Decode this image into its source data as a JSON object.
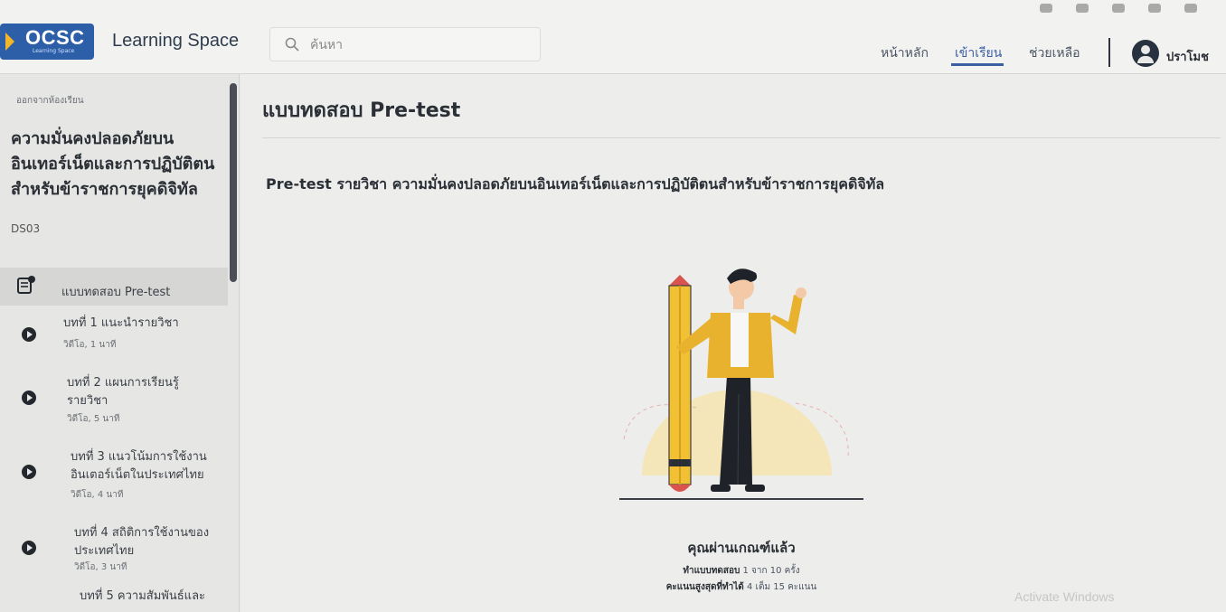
{
  "header": {
    "logo_text": "OCSC",
    "logo_subtext": "Learning Space",
    "app_title": "Learning Space",
    "search_placeholder": "ค้นหา",
    "nav": [
      {
        "label": "หน้าหลัก"
      },
      {
        "label": "เข้าเรียน"
      },
      {
        "label": "ช่วยเหลือ"
      }
    ],
    "user_name": "ปราโมช"
  },
  "sidebar": {
    "back_label": "ออกจากห้องเรียน",
    "course_title": "ความมั่นคงปลอดภัยบนอินเทอร์เน็ตและการปฏิบัติตนสำหรับข้าราชการยุคดิจิทัล",
    "course_code": "DS03",
    "pretest_label": "แบบทดสอบ Pre-test",
    "lessons": [
      {
        "title": "บทที่ 1 แนะนำรายวิชา",
        "meta": "วิดีโอ, 1 นาที"
      },
      {
        "title": "บทที่ 2 แผนการเรียนรู้รายวิชา",
        "meta": "วิดีโอ, 5 นาที"
      },
      {
        "title": "บทที่ 3 แนวโน้มการใช้งานอินเตอร์เน็ตในประเทศไทย",
        "meta": "วิดีโอ, 4 นาที"
      },
      {
        "title": "บทที่ 4 สถิติการใช้งานของประเทศไทย",
        "meta": "วิดีโอ, 3 นาที"
      },
      {
        "title": "บทที่ 5 ความสัมพันธ์และ",
        "meta": ""
      }
    ]
  },
  "main": {
    "page_title": "แบบทดสอบ Pre-test",
    "subtitle": "Pre-test รายวิชา ความมั่นคงปลอดภัยบนอินเทอร์เน็ตและการปฏิบัติตนสำหรับข้าราชการยุคดิจิทัล",
    "result_title": "คุณผ่านเกณฑ์แล้ว",
    "attempts_label": "ทำแบบทดสอบ",
    "attempts_value": "1 จาก 10 ครั้ง",
    "best_score_label": "คะแนนสูงสุดที่ทำได้",
    "best_score_value": "4 เต็ม 15 คะแนน"
  },
  "os": {
    "watermark": "Activate Windows"
  },
  "colors": {
    "accent": "#3a5fa5",
    "logo_bg": "#2d5fa8",
    "pencil": "#f2c033",
    "jacket": "#e8b22e"
  }
}
